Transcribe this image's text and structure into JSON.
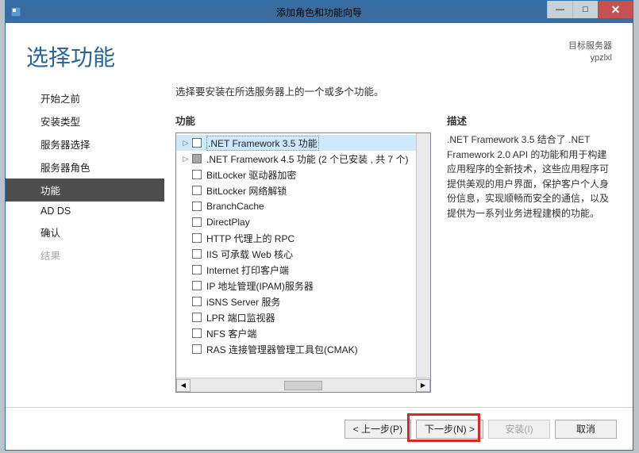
{
  "titlebar": {
    "title": "添加角色和功能向导"
  },
  "target": {
    "label": "目标服务器",
    "value": "ypzlxl"
  },
  "heading": "选择功能",
  "sidebar": {
    "items": [
      {
        "label": "开始之前"
      },
      {
        "label": "安装类型"
      },
      {
        "label": "服务器选择"
      },
      {
        "label": "服务器角色"
      },
      {
        "label": "功能",
        "active": true
      },
      {
        "label": "AD DS"
      },
      {
        "label": "确认"
      },
      {
        "label": "结果",
        "disabled": true
      }
    ]
  },
  "instruction": "选择要安装在所选服务器上的一个或多个功能。",
  "features_label": "功能",
  "desc_label": "描述",
  "desc_text": ".NET Framework 3.5 结合了 .NET Framework 2.0 API 的功能和用于构建应用程序的全新技术，这些应用程序可提供美观的用户界面，保护客户个人身份信息，实现顺畅而安全的通信，以及提供为一系列业务进程建模的功能。",
  "features": [
    {
      "label": ".NET Framework 3.5 功能",
      "expander": true,
      "selected": true
    },
    {
      "label": ".NET Framework 4.5 功能 (2 个已安装 , 共 7 个)",
      "expander": true,
      "semi": true
    },
    {
      "label": "BitLocker 驱动器加密"
    },
    {
      "label": "BitLocker 网络解锁"
    },
    {
      "label": "BranchCache"
    },
    {
      "label": "DirectPlay"
    },
    {
      "label": "HTTP 代理上的 RPC"
    },
    {
      "label": "IIS 可承载 Web 核心"
    },
    {
      "label": "Internet 打印客户端"
    },
    {
      "label": "IP 地址管理(IPAM)服务器"
    },
    {
      "label": "iSNS Server 服务"
    },
    {
      "label": "LPR 端口监视器"
    },
    {
      "label": "NFS 客户端"
    },
    {
      "label": "RAS 连接管理器管理工具包(CMAK)"
    }
  ],
  "buttons": {
    "prev": "< 上一步(P)",
    "next": "下一步(N) >",
    "install": "安装(I)",
    "cancel": "取消"
  }
}
